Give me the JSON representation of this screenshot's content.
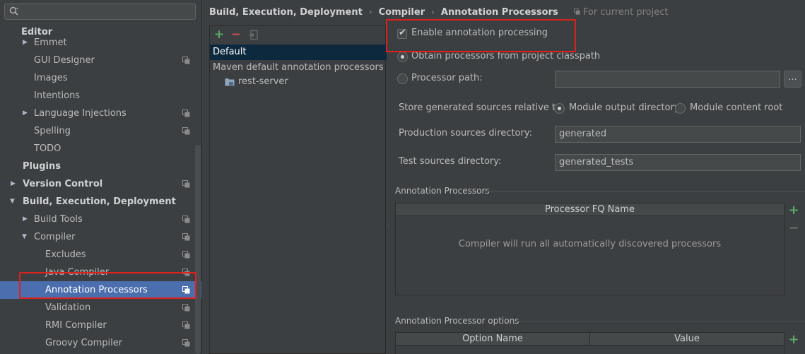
{
  "sidebar": {
    "search": {
      "value": "",
      "placeholder": ""
    },
    "items": [
      {
        "label": "Editor"
      },
      {
        "label": "Emmet"
      },
      {
        "label": "GUI Designer"
      },
      {
        "label": "Images"
      },
      {
        "label": "Intentions"
      },
      {
        "label": "Language Injections"
      },
      {
        "label": "Spelling"
      },
      {
        "label": "TODO"
      },
      {
        "label": "Plugins"
      },
      {
        "label": "Version Control"
      },
      {
        "label": "Build, Execution, Deployment"
      },
      {
        "label": "Build Tools"
      },
      {
        "label": "Compiler"
      },
      {
        "label": "Excludes"
      },
      {
        "label": "Java Compiler"
      },
      {
        "label": "Annotation Processors"
      },
      {
        "label": "Validation"
      },
      {
        "label": "RMI Compiler"
      },
      {
        "label": "Groovy Compiler"
      }
    ]
  },
  "breadcrumb": {
    "items": [
      "Build, Execution, Deployment",
      "Compiler",
      "Annotation Processors"
    ],
    "separator": "›",
    "scope": "For current project"
  },
  "profiles": {
    "toolbar": {
      "add": "+",
      "remove": "−"
    },
    "rows": [
      {
        "label": "Default"
      },
      {
        "label": "Maven default annotation processors profile"
      },
      {
        "label": "rest-server"
      }
    ]
  },
  "settings": {
    "enable_processing": {
      "label": "Enable annotation processing",
      "checked": true
    },
    "obtain_from_classpath": {
      "label": "Obtain processors from project classpath",
      "selected": true
    },
    "processor_path": {
      "label": "Processor path:",
      "value": "",
      "browse_label": "..."
    },
    "store_relative": {
      "label": "Store generated sources relative to:",
      "option_output": "Module output directory",
      "option_content": "Module content root",
      "selected": "Module output directory"
    },
    "production_dir": {
      "label": "Production sources directory:",
      "value": "generated"
    },
    "test_dir": {
      "label": "Test sources directory:",
      "value": "generated_tests"
    }
  },
  "processors_section": {
    "title": "Annotation Processors",
    "column": "Processor FQ Name",
    "empty_text": "Compiler will run all automatically discovered processors",
    "add": "+",
    "remove": "−"
  },
  "options_section": {
    "title": "Annotation Processor options",
    "columns": [
      "Option Name",
      "Value"
    ],
    "add": "+"
  },
  "colors": {
    "accent_green": "#59a869",
    "remove_red": "#c75450",
    "selection": "#4b6eaf",
    "highlight_red": "#e0201b"
  }
}
